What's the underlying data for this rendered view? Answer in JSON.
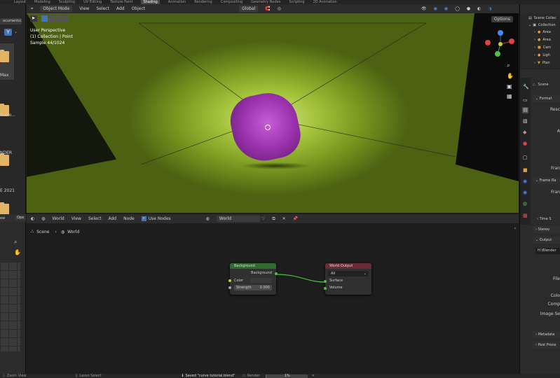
{
  "workspace_tabs": [
    "Layout",
    "Modeling",
    "Sculpting",
    "UV Editing",
    "Texture Paint",
    "Shading",
    "Animation",
    "Rendering",
    "Compositing",
    "Geometry Nodes",
    "Scripting",
    "2D Animation"
  ],
  "active_tab": "Shading",
  "viewport": {
    "mode": "Object Mode",
    "menu": [
      "View",
      "Select",
      "Add",
      "Object"
    ],
    "orientation": "Global",
    "options": "Options",
    "overlay_lines": [
      "User Perspective",
      "(1) Collection | Point",
      "Sample 44/1024"
    ]
  },
  "file_browser": {
    "path_btn": "ocuments\\",
    "items": [
      "Max",
      "d sho...",
      "NDER",
      "E 2021",
      ""
    ],
    "lower_btn": "Ope"
  },
  "node_editor": {
    "type": "World",
    "menu": [
      "View",
      "Select",
      "Add",
      "Node"
    ],
    "use_nodes_label": "Use Nodes",
    "world_name": "World",
    "breadcrumb": [
      "Scene",
      "World"
    ],
    "background_node": {
      "title": "Background",
      "output": "Background",
      "color_label": "Color",
      "strength_label": "Strength",
      "strength_value": "0.000"
    },
    "world_output_node": {
      "title": "World Output",
      "target": "All",
      "surface": "Surface",
      "volume": "Volume"
    }
  },
  "outliner": {
    "root": "Scene Collec",
    "collection": "Collection",
    "items": [
      "Area",
      "Area",
      "Cam",
      "Ligh",
      "Plan"
    ]
  },
  "properties": {
    "scene_label": "Scene",
    "format": "Format",
    "resolution": "Resc",
    "row_a": "A",
    "frame_rate_short": "Fran",
    "frame_range": "Frame Ra",
    "frame_range_sub": "Fran",
    "time_stretch": "Time S",
    "stereo": "Stereo",
    "output": "Output",
    "output_path": "H:\\Blender",
    "file": "File",
    "color": "Colo",
    "compression": "Comp",
    "image_seq": "Image Se",
    "metadata": "Metadata",
    "post_processing": "Post Proce"
  },
  "status_bar": {
    "zoom": "Zoom View",
    "lasso": "Lasso Select",
    "saved": "Saved \"curve tutorial.blend\"",
    "render": "Render",
    "render_progress": "1%",
    "render_fraction": 0.01
  },
  "colors": {
    "accent_blue": "#4772b3",
    "background_node": "#2f6a2f",
    "world_output_node": "#6b2a38",
    "link": "#4cbd46",
    "object": "#a23ab5"
  }
}
